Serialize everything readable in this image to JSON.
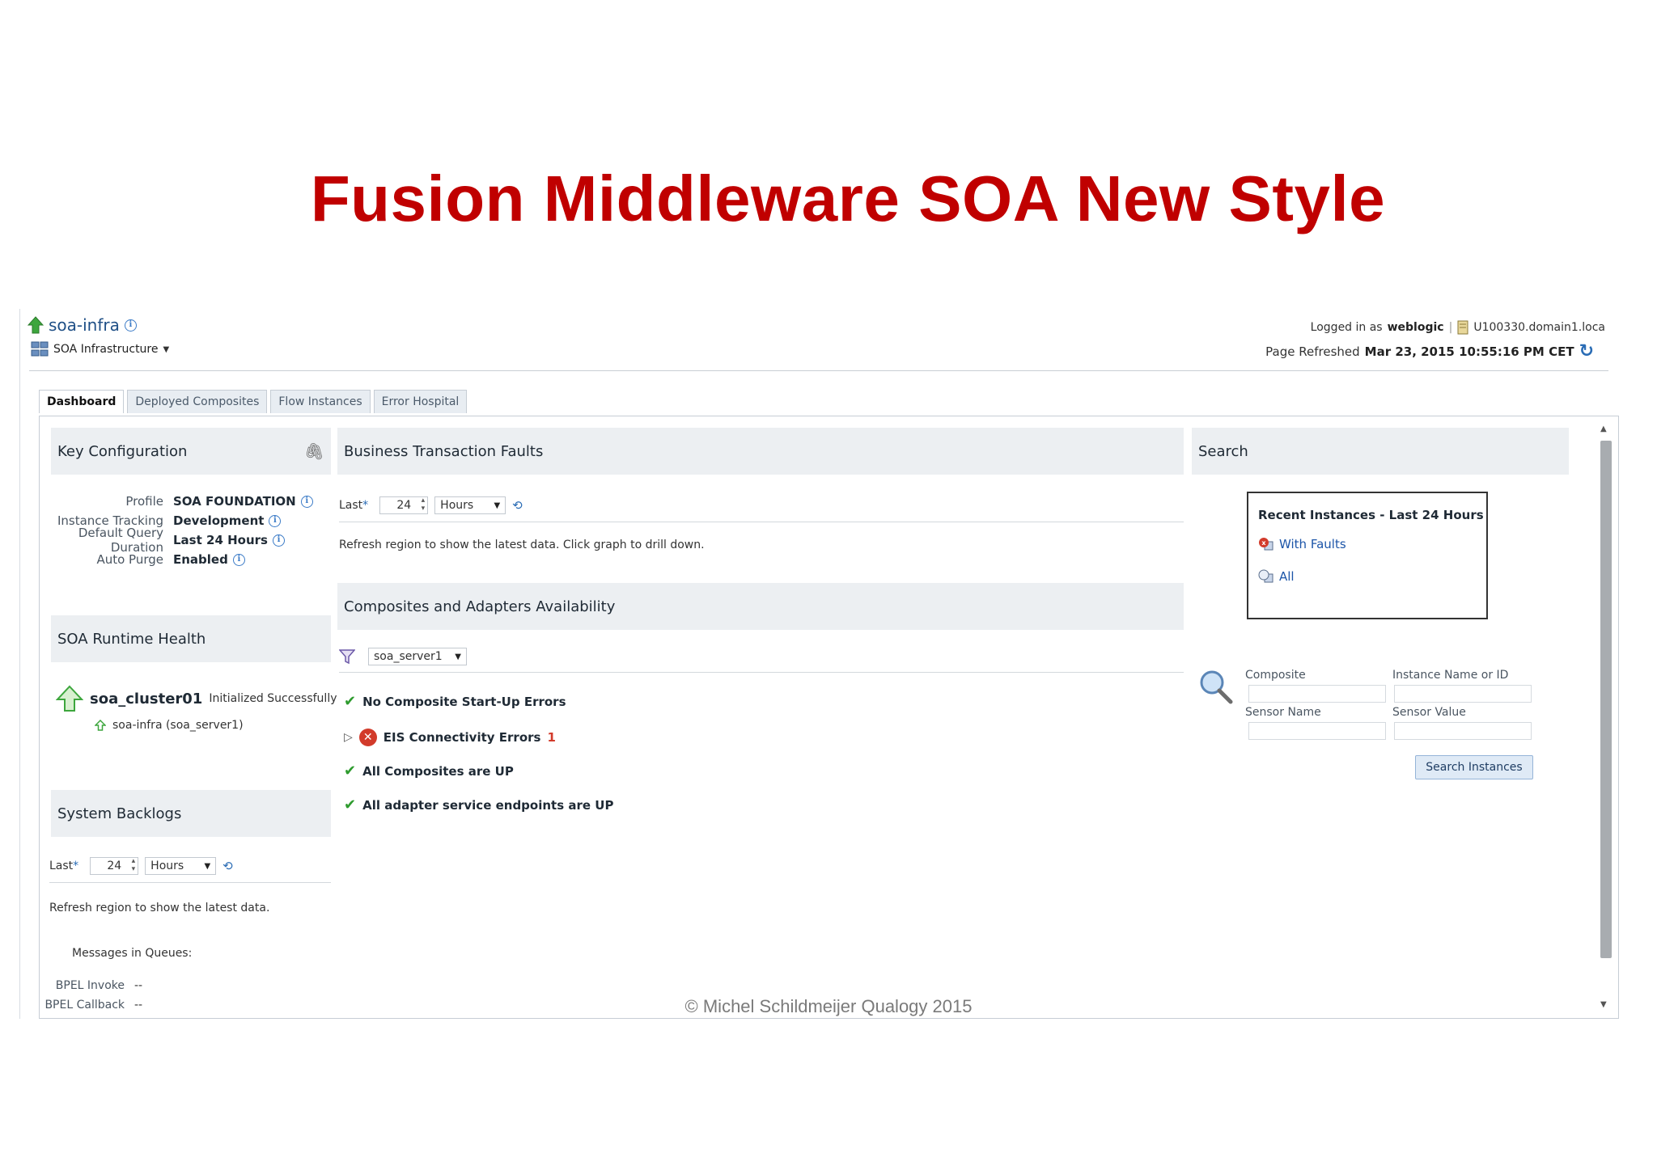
{
  "slide": {
    "title": "Fusion Middleware SOA New Style",
    "footer": "© Michel Schildmeijer Qualogy 2015"
  },
  "header": {
    "app_name": "soa-infra",
    "app_menu": "SOA Infrastructure",
    "logged_in_prefix": "Logged in as",
    "user": "weblogic",
    "host": "U100330.domain1.loca",
    "refreshed_prefix": "Page Refreshed",
    "refreshed_time": "Mar 23, 2015 10:55:16 PM CET"
  },
  "tabs": [
    {
      "label": "Dashboard",
      "active": true
    },
    {
      "label": "Deployed Composites",
      "active": false
    },
    {
      "label": "Flow Instances",
      "active": false
    },
    {
      "label": "Error Hospital",
      "active": false
    }
  ],
  "key_config": {
    "title": "Key Configuration",
    "rows": [
      {
        "label": "Profile",
        "value": "SOA FOUNDATION"
      },
      {
        "label": "Instance Tracking",
        "value": "Development"
      },
      {
        "label": "Default Query Duration",
        "value": "Last 24 Hours"
      },
      {
        "label": "Auto Purge",
        "value": "Enabled"
      }
    ]
  },
  "runtime_health": {
    "title": "SOA Runtime Health",
    "cluster": "soa_cluster01",
    "cluster_status": "Initialized Successfully",
    "server": "soa-infra (soa_server1)"
  },
  "backlogs": {
    "title": "System Backlogs",
    "last_label": "Last",
    "req": "*",
    "last_value": "24",
    "unit": "Hours",
    "note": "Refresh region to show the latest data.",
    "queues_label": "Messages in Queues:",
    "queues": [
      {
        "label": "BPEL Invoke",
        "value": "--"
      },
      {
        "label": "BPEL Callback",
        "value": "--"
      }
    ]
  },
  "btf": {
    "title": "Business Transaction Faults",
    "last_label": "Last",
    "req": "*",
    "last_value": "24",
    "unit": "Hours",
    "note": "Refresh region to show the latest data. Click graph to drill down."
  },
  "availability": {
    "title": "Composites and Adapters Availability",
    "server": "soa_server1",
    "items": [
      {
        "label": "No Composite Start-Up Errors"
      },
      {
        "label": "EIS Connectivity Errors",
        "count": "1"
      },
      {
        "label": "All Composites are UP"
      },
      {
        "label": "All adapter service endpoints are UP"
      }
    ]
  },
  "search": {
    "title": "Search",
    "recent_title": "Recent Instances - Last 24 Hours",
    "with_faults": "With Faults",
    "all": "All",
    "fields": {
      "composite": "Composite",
      "instance": "Instance Name or ID",
      "sensor_name": "Sensor Name",
      "sensor_value": "Sensor Value"
    },
    "button": "Search Instances"
  },
  "colors": {
    "title": "#c00000",
    "link": "#1c55a8",
    "ok": "#2e9b2e",
    "error": "#d23b2b"
  }
}
